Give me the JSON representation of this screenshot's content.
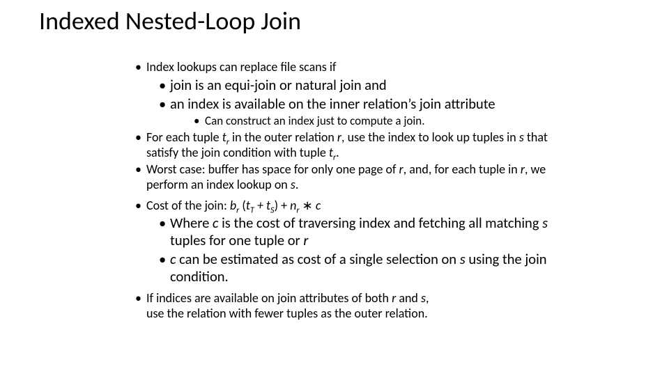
{
  "title": "Indexed Nested-Loop Join",
  "bullets": {
    "l1_a": "Index lookups can replace file scans if",
    "l2_a": "join is an equi-join or natural join and",
    "l2_b_pre": "an index is available on the inner relation",
    "l2_b_post": "s join attribute",
    "l3_a": "Can construct an index just to compute a join.",
    "l1_b_1": "For each tuple ",
    "l1_b_tr": "t",
    "l1_b_r": "r",
    "l1_b_2": " in the outer relation ",
    "l1_b_rrel": "r",
    "l1_b_3": ", use the index to look up tuples in ",
    "l1_b_s": "s",
    "l1_b_4": " that satisfy the join condition with tuple ",
    "l1_b_tr2": "t",
    "l1_b_r2": "r",
    "l1_b_5": ".",
    "l1_c_1": "Worst case:  buffer has space for only one page of ",
    "l1_c_r": "r",
    "l1_c_2": ", and, for each tuple in ",
    "l1_c_r2": "r",
    "l1_c_3": ", we perform an index lookup on ",
    "l1_c_s": "s",
    "l1_c_4": ".",
    "l1_d_1": "Cost of the join:  ",
    "l1_d_b": "b",
    "l1_d_br": "r",
    "l1_d_2": " (",
    "l1_d_t1": "t",
    "l1_d_T": "T",
    "l1_d_3": " + ",
    "l1_d_t2": "t",
    "l1_d_S": "S",
    "l1_d_4": ") + ",
    "l1_d_n": "n",
    "l1_d_nr": "r",
    "l1_d_5": " ∗ ",
    "l1_d_c": "c",
    "l2_e_1": "Where ",
    "l2_e_c": "c",
    "l2_e_2": " is the cost of traversing index and fetching all matching ",
    "l2_e_s": "s",
    "l2_e_3": " tuples for one tuple or ",
    "l2_e_r": "r",
    "l2_f_c": "c",
    "l2_f_1": " can be estimated as cost of a single selection on ",
    "l2_f_s": "s",
    "l2_f_2": " using the join condition.",
    "l1_g_1": "If indices are available on join attributes of both ",
    "l1_g_r": "r",
    "l1_g_2": " and ",
    "l1_g_s": "s",
    "l1_g_3": ",",
    "l1_g_4": "use the relation with fewer tuples as the outer relation."
  },
  "apos": "’"
}
